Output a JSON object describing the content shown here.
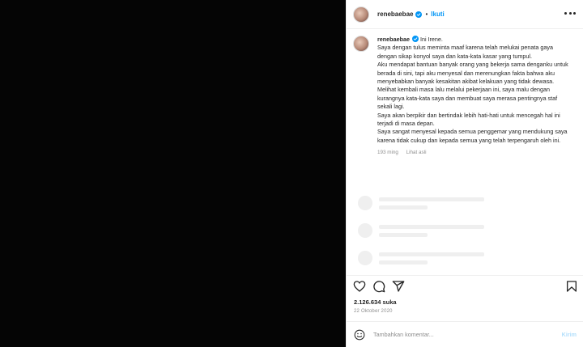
{
  "header": {
    "username": "renebaebae",
    "separator": "•",
    "follow_label": "Ikuti",
    "verified_icon": "verified-badge-icon",
    "more_icon": "more-options-icon"
  },
  "caption": {
    "username": "renebaebae",
    "text": "Ini Irene.\nSaya dengan tulus meminta maaf karena telah melukai penata gaya dengan sikap konyol saya dan kata-kata kasar yang tumpul.\nAku mendapat bantuan banyak orang yang bekerja sama denganku untuk berada di sini, tapi aku menyesal dan merenungkan fakta bahwa aku menyebabkan banyak kesakitan akibat kelakuan yang tidak dewasa.\nMelihat kembali masa lalu melalui pekerjaan ini, saya malu dengan kurangnya kata-kata saya dan membuat saya merasa pentingnya staf sekali lagi.\nSaya akan berpikir dan bertindak lebih hati-hati untuk mencegah hal ini terjadi di masa depan.\nSaya sangat menyesal kepada semua penggemar yang mendukung saya karena tidak cukup dan kepada semua yang telah terpengaruh oleh ini.",
    "age": "193 ming",
    "see_translation": "Lihat asli"
  },
  "actions": {
    "icons": [
      "heart-icon",
      "comment-icon",
      "share-icon",
      "bookmark-icon"
    ]
  },
  "likes": "2.126.634 suka",
  "date": "22 Oktober 2020",
  "comment": {
    "placeholder": "Tambahkan komentar...",
    "post_label": "Kirim",
    "emoji_icon": "emoji-icon"
  },
  "colors": {
    "accent": "#0095f6",
    "post_disabled": "#b2dffc",
    "media_bg": "#050505",
    "verified": "#0095f6"
  }
}
